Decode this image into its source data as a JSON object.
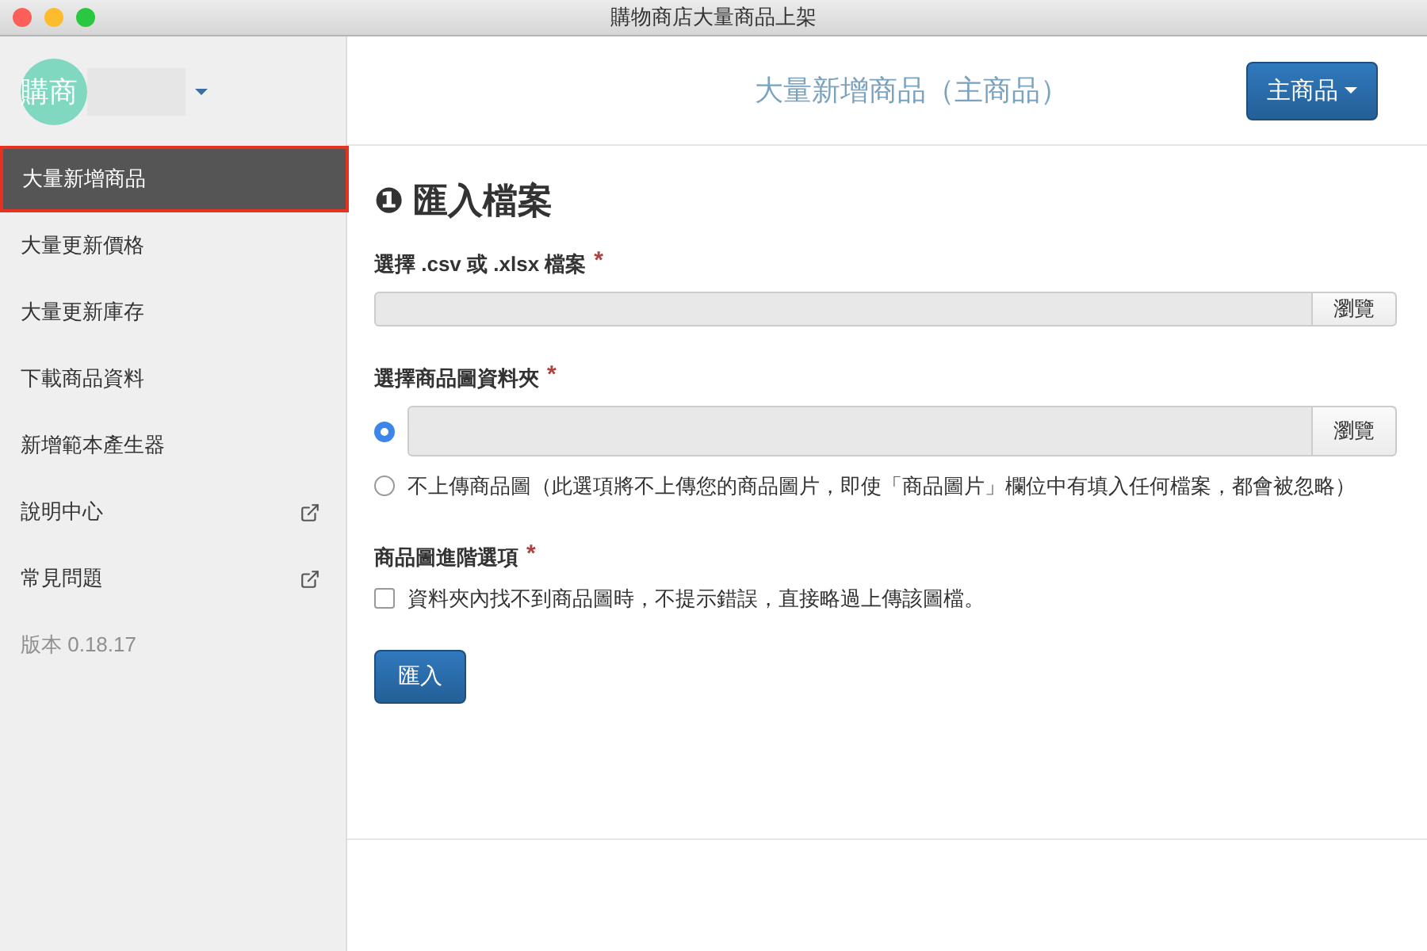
{
  "window": {
    "title": "購物商店大量商品上架"
  },
  "account": {
    "avatar_text": "購商"
  },
  "sidebar": {
    "items": [
      {
        "label": "大量新增商品",
        "selected": true,
        "external": false
      },
      {
        "label": "大量更新價格",
        "selected": false,
        "external": false
      },
      {
        "label": "大量更新庫存",
        "selected": false,
        "external": false
      },
      {
        "label": "下載商品資料",
        "selected": false,
        "external": false
      },
      {
        "label": "新增範本產生器",
        "selected": false,
        "external": false
      },
      {
        "label": "說明中心",
        "selected": false,
        "external": true
      },
      {
        "label": "常見問題",
        "selected": false,
        "external": true
      }
    ],
    "version": "版本 0.18.17"
  },
  "header": {
    "title": "大量新增商品（主商品）",
    "menu_button": "主商品"
  },
  "form": {
    "heading": "❶ 匯入檔案",
    "file_field": {
      "label": "選擇 .csv 或 .xlsx 檔案",
      "required_mark": "*",
      "browse": "瀏覽"
    },
    "folder_field": {
      "label": "選擇商品圖資料夾",
      "required_mark": "*",
      "options": [
        {
          "kind": "folder",
          "selected": true,
          "browse": "瀏覽"
        },
        {
          "kind": "text",
          "selected": false,
          "label": "不上傳商品圖（此選項將不上傳您的商品圖片，即使「商品圖片」欄位中有填入任何檔案，都會被忽略）"
        }
      ]
    },
    "advanced": {
      "label": "商品圖進階選項",
      "required_mark": "*",
      "checkbox": {
        "label": "資料夾內找不到商品圖時，不提示錯誤，直接略過上傳該圖檔。",
        "checked": false
      }
    },
    "submit": "匯入"
  }
}
